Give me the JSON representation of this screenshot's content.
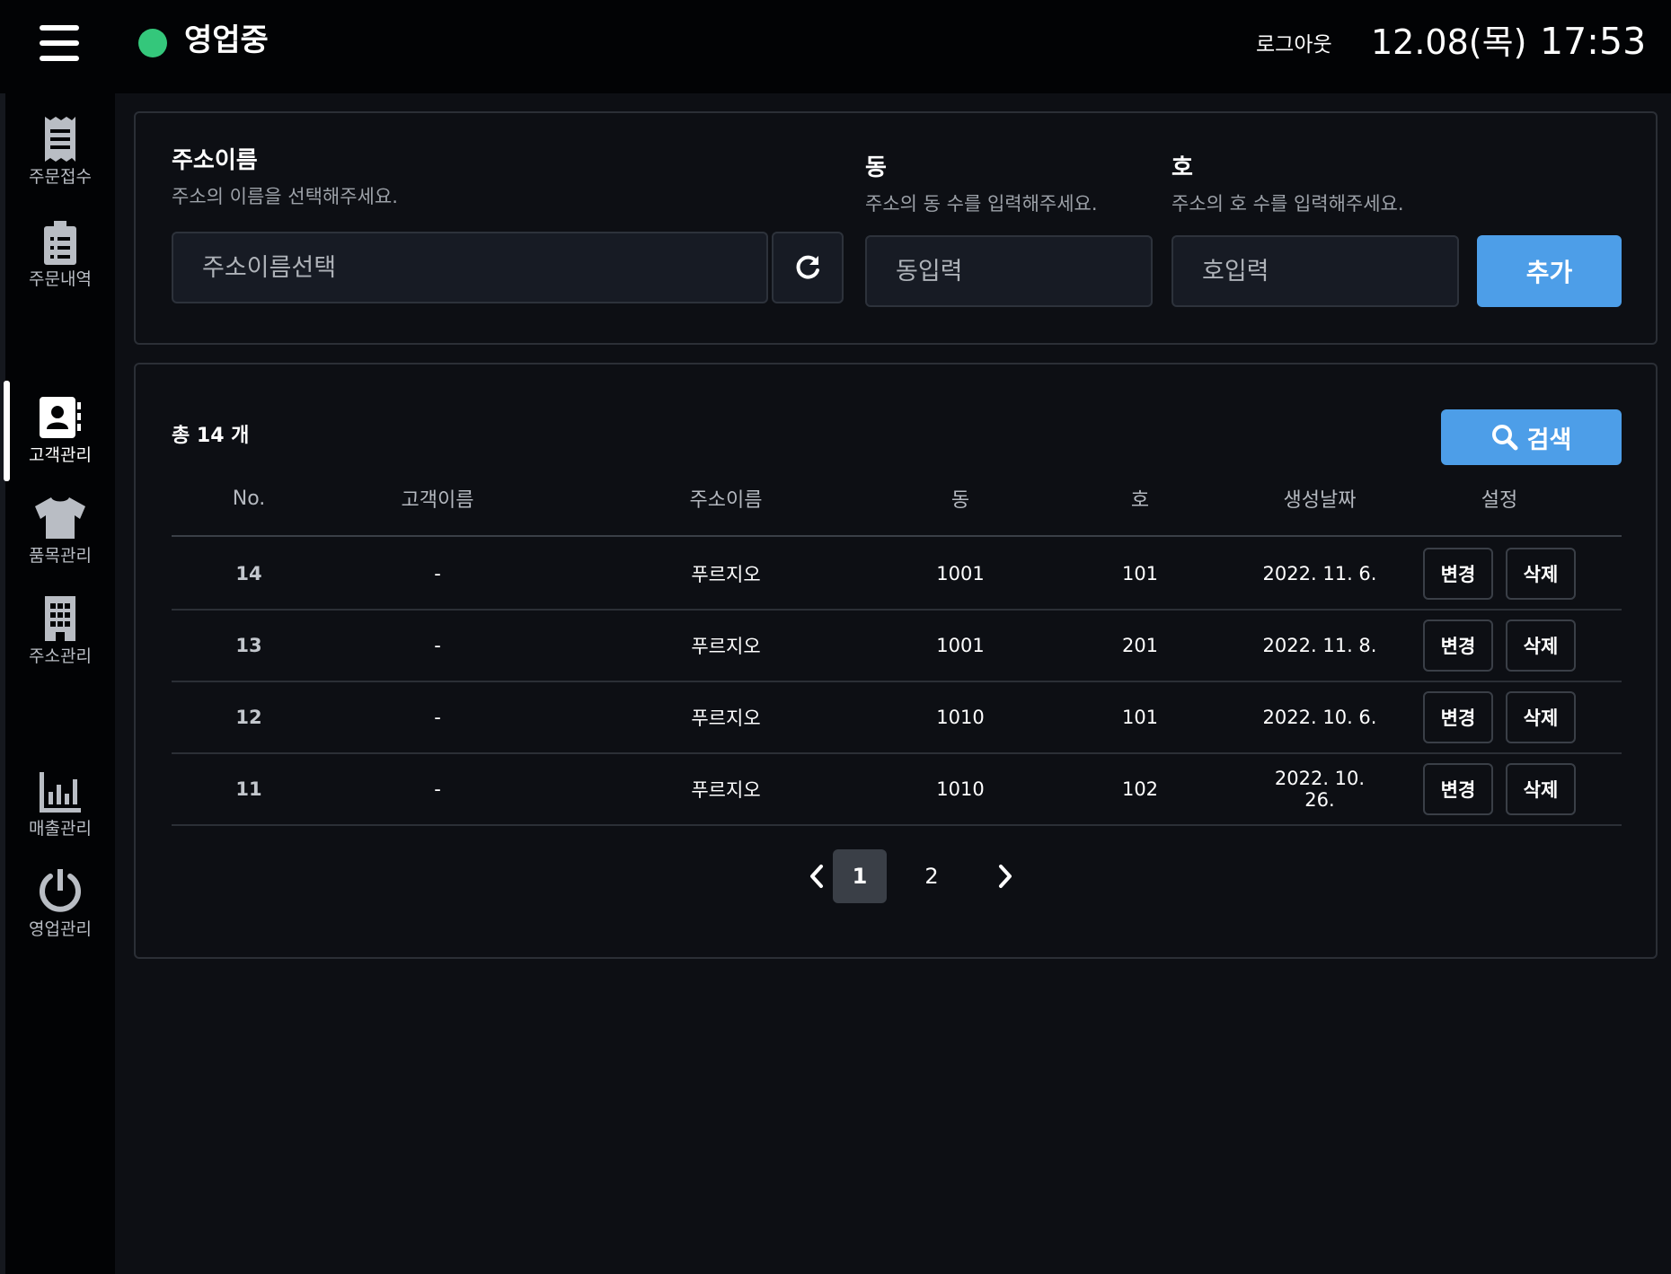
{
  "header": {
    "status_text": "영업중",
    "status_color": "#34c77b",
    "logout_label": "로그아웃",
    "date": "12.08(목)",
    "time": "17:53"
  },
  "sidebar": {
    "items": [
      {
        "label": "주문접수",
        "icon": "receipt-icon"
      },
      {
        "label": "주문내역",
        "icon": "clipboard-list-icon"
      },
      {
        "label": "고객관리",
        "icon": "contact-book-icon",
        "active": true
      },
      {
        "label": "품목관리",
        "icon": "shirt-icon"
      },
      {
        "label": "주소관리",
        "icon": "building-icon"
      },
      {
        "label": "매출관리",
        "icon": "bar-chart-icon"
      },
      {
        "label": "영업관리",
        "icon": "power-icon"
      }
    ]
  },
  "form": {
    "address_name": {
      "title": "주소이름",
      "desc": "주소의 이름을 선택해주세요.",
      "placeholder": "주소이름선택"
    },
    "dong": {
      "title": "동",
      "desc": "주소의 동 수를 입력해주세요.",
      "placeholder": "동입력"
    },
    "ho": {
      "title": "호",
      "desc": "주소의 호 수를 입력해주세요.",
      "placeholder": "호입력"
    },
    "add_label": "추가"
  },
  "list": {
    "total_label": "총 14 개",
    "search_label": "검색",
    "columns": [
      "No.",
      "고객이름",
      "주소이름",
      "동",
      "호",
      "생성날짜",
      "설정"
    ],
    "rows": [
      {
        "no": "14",
        "customer": "-",
        "address": "푸르지오",
        "dong": "1001",
        "ho": "101",
        "date": "2022. 11. 6."
      },
      {
        "no": "13",
        "customer": "-",
        "address": "푸르지오",
        "dong": "1001",
        "ho": "201",
        "date": "2022. 11. 8."
      },
      {
        "no": "12",
        "customer": "-",
        "address": "푸르지오",
        "dong": "1010",
        "ho": "101",
        "date": "2022. 10. 6."
      },
      {
        "no": "11",
        "customer": "-",
        "address": "푸르지오",
        "dong": "1010",
        "ho": "102",
        "date": "2022. 10. 26."
      }
    ],
    "edit_label": "변경",
    "delete_label": "삭제",
    "pagination": {
      "pages": [
        "1",
        "2"
      ],
      "current": "1"
    }
  },
  "colors": {
    "accent": "#4d9ee8",
    "delete": "#f26d6d"
  }
}
